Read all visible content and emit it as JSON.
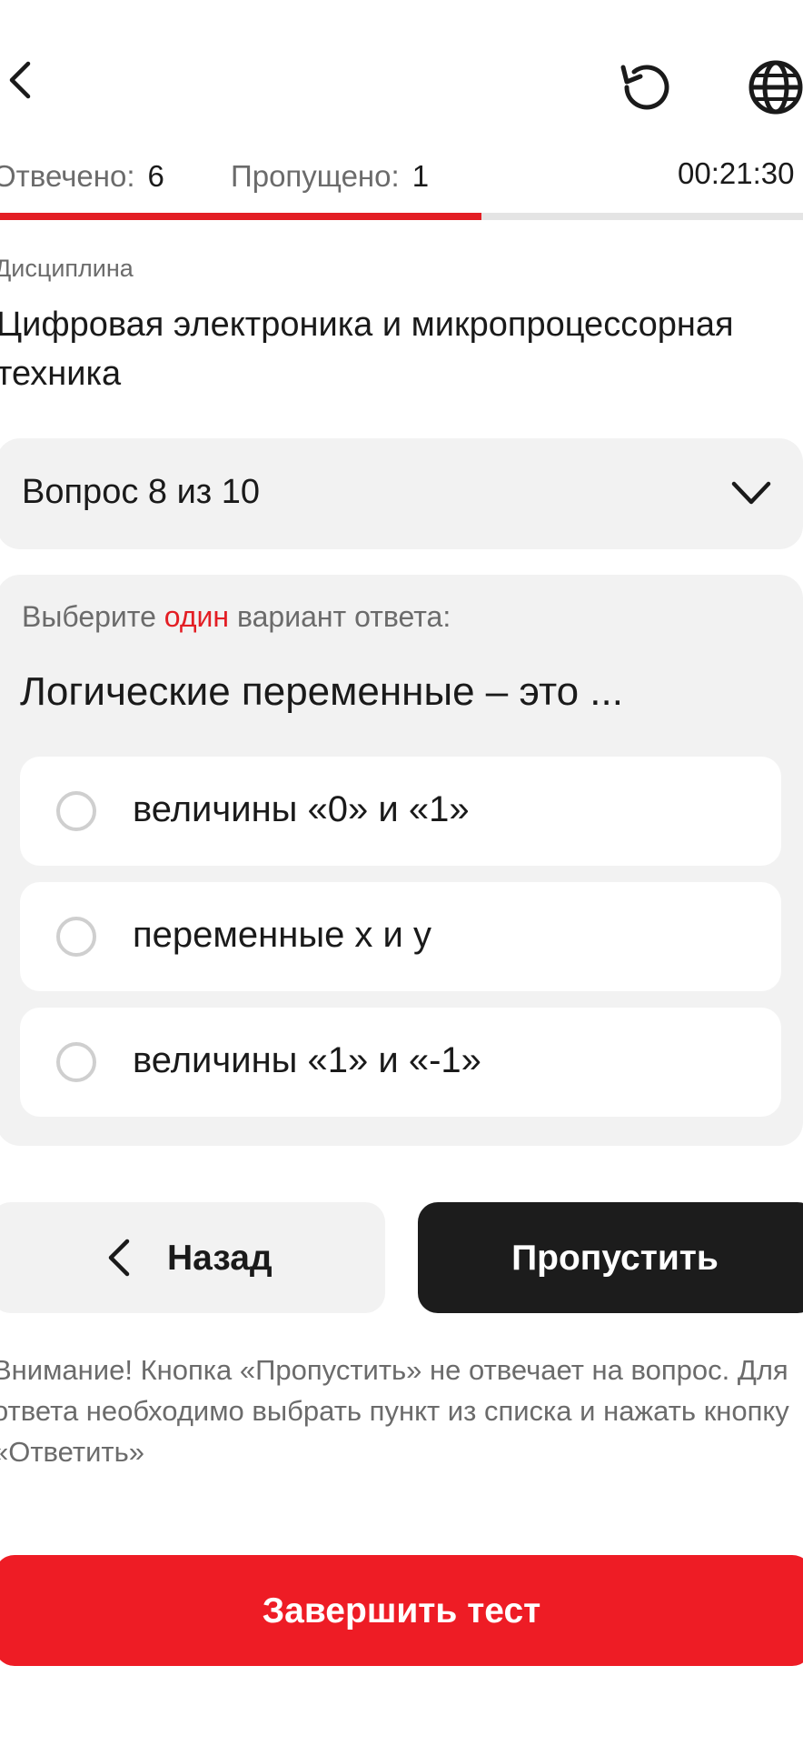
{
  "header": {
    "back_icon": "chevron-left-icon",
    "restart_icon": "refresh-icon",
    "language_icon": "globe-icon"
  },
  "stats": {
    "answered_label": "Отвечено:",
    "answered_value": "6",
    "skipped_label": "Пропущено:",
    "skipped_value": "1",
    "timer": "00:21:30"
  },
  "progress": {
    "fraction": 0.6
  },
  "discipline": {
    "caption": "Дисциплина",
    "title": "Цифровая электроника и микропроцессорная техника"
  },
  "question_selector": {
    "label": "Вопрос 8 из 10",
    "icon": "chevron-down-icon"
  },
  "question": {
    "instruction_prefix": "Выберите ",
    "instruction_accent": "один",
    "instruction_suffix": " вариант ответа:",
    "text": "Логические переменные – это ...",
    "options": [
      {
        "label": "величины «0» и «1»"
      },
      {
        "label": "переменные x и y"
      },
      {
        "label": "величины «1» и «-1»"
      }
    ]
  },
  "buttons": {
    "back_label": "Назад",
    "skip_label": "Пропустить",
    "finish_label": "Завершить тест"
  },
  "warning": "Внимание! Кнопка «Пропустить» не отвечает на вопрос. Для ответа необходимо выбрать пункт из списка и нажать кнопку «Ответить»",
  "colors": {
    "accent": "#e31e24",
    "dark_button": "#1c1c1c",
    "card_bg": "#f2f2f2",
    "muted_text": "#6b6b6b"
  }
}
